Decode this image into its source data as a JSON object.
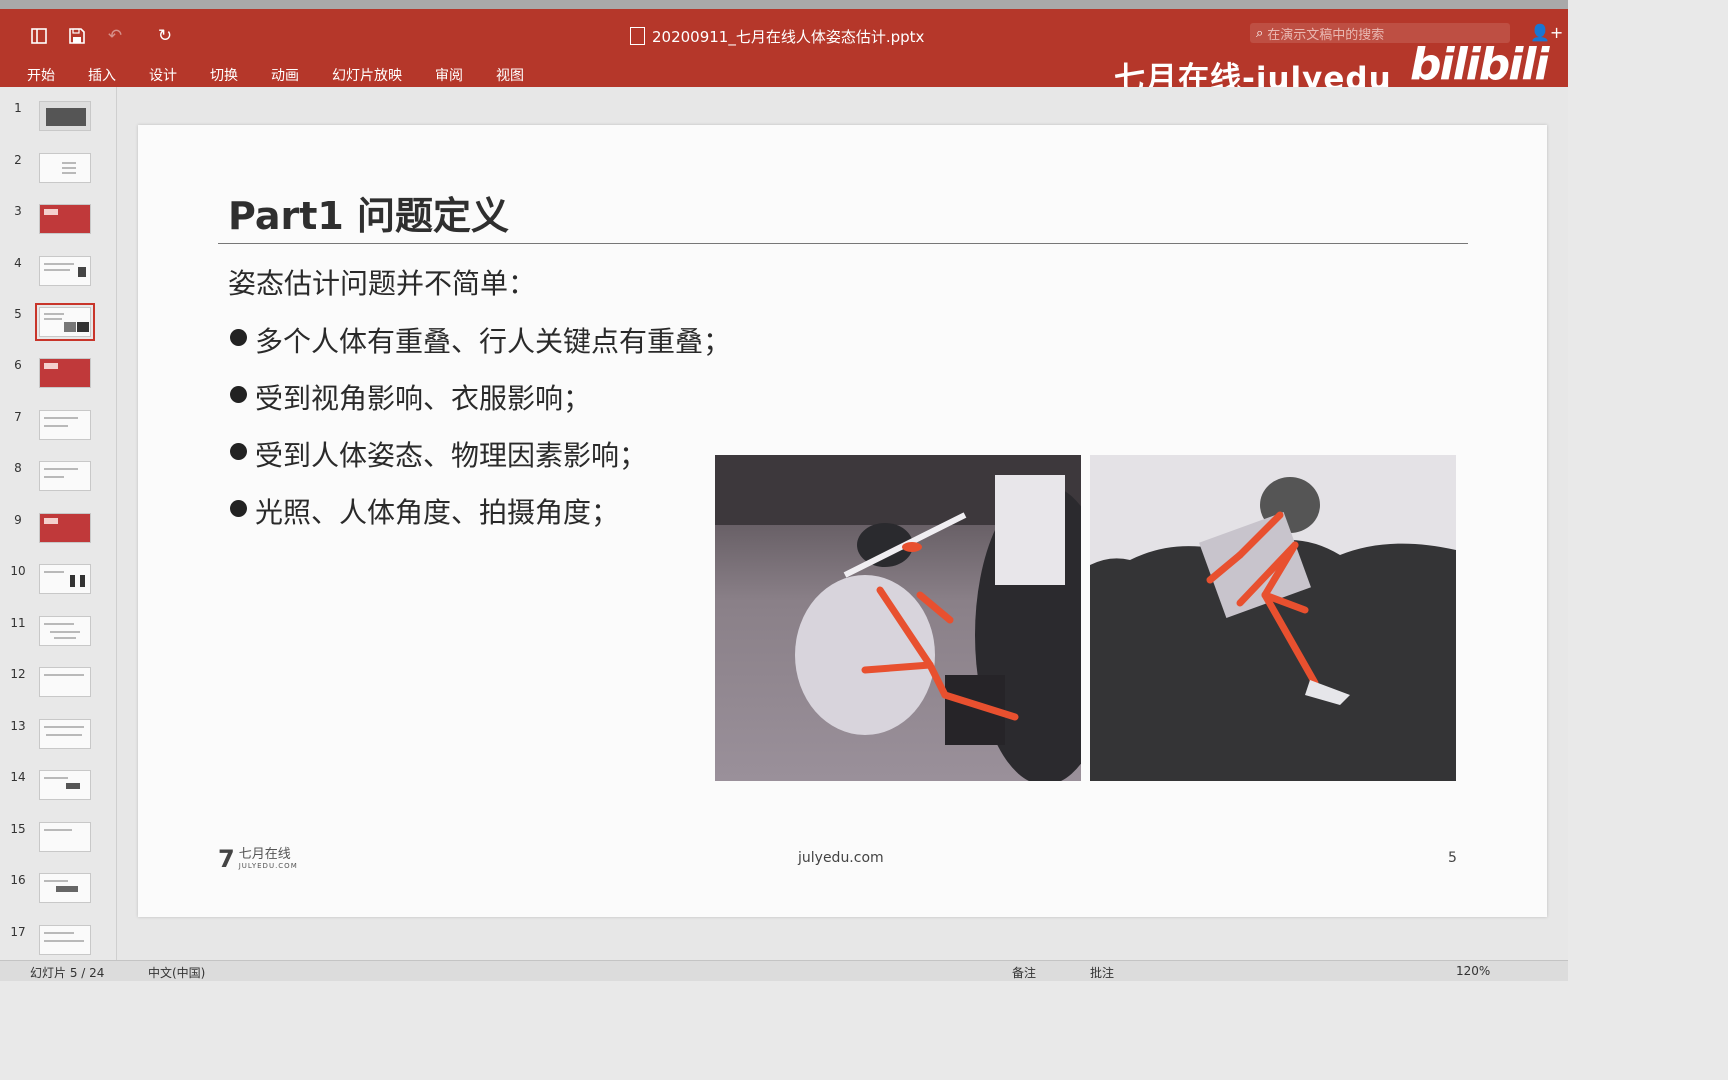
{
  "window": {
    "title": "20200911_七月在线人体姿态估计.pptx",
    "search_placeholder": "在演示文稿中的搜索"
  },
  "ribbon": {
    "tabs": [
      "开始",
      "插入",
      "设计",
      "切换",
      "动画",
      "幻灯片放映",
      "审阅",
      "视图"
    ]
  },
  "watermark": {
    "brand": "七月在线-julyedu",
    "site_logo": "bilibili"
  },
  "slides": {
    "numbers": [
      "1",
      "2",
      "3",
      "4",
      "5",
      "6",
      "7",
      "8",
      "9",
      "10",
      "11",
      "12",
      "13",
      "14",
      "15",
      "16",
      "17"
    ],
    "active": "5"
  },
  "slide": {
    "title": "Part1 问题定义",
    "intro": "姿态估计问题并不简单：",
    "bullets": [
      "多个人体有重叠、行人关键点有重叠；",
      "受到视角影响、衣服影响；",
      "受到人体姿态、物理因素影响；",
      "光照、人体角度、拍摄角度；"
    ],
    "footer": {
      "logo_cn": "七月在线",
      "logo_en": "JULYEDU.COM",
      "url": "julyedu.com",
      "page": "5"
    }
  },
  "statusbar": {
    "slide_info": "幻灯片 5 / 24",
    "language": "中文(中国)",
    "notes": "备注",
    "comments": "批注",
    "zoom": "120%"
  },
  "icons": [
    "sidebar-toggle-icon",
    "save-icon",
    "undo-icon",
    "redo-icon",
    "file-icon",
    "search-icon",
    "add-user-icon"
  ],
  "colors": {
    "ribbon": "#b5372a",
    "active_thumb": "#c8352a",
    "skeleton": "#e8502f"
  }
}
